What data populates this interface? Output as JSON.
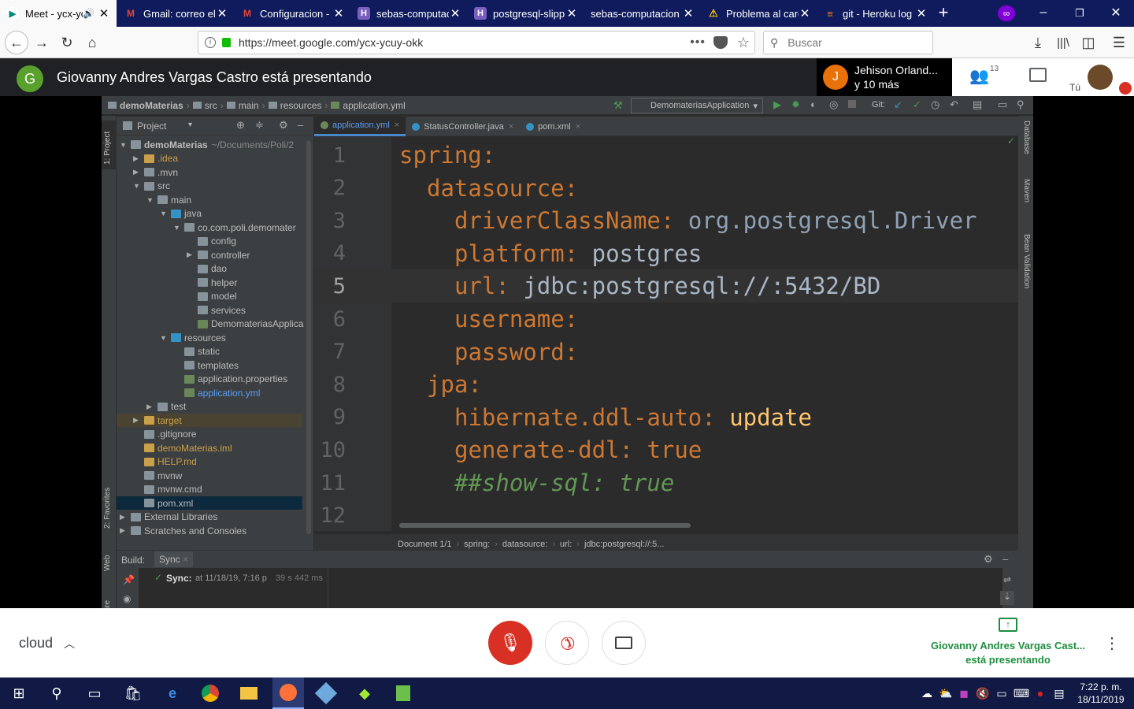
{
  "browser": {
    "tabs": [
      {
        "label": "Meet - ycx-yc",
        "icon": "meet-icon",
        "active": true
      },
      {
        "label": "Gmail: correo el",
        "icon": "gmail-icon"
      },
      {
        "label": "Configuracion -",
        "icon": "gmail-icon"
      },
      {
        "label": "sebas-computac",
        "icon": "heroku-icon"
      },
      {
        "label": "postgresql-slipp",
        "icon": "heroku-icon"
      },
      {
        "label": "sebas-computacion",
        "icon": "blank-icon"
      },
      {
        "label": "Problema al carg",
        "icon": "warning-icon"
      },
      {
        "label": "git - Heroku log",
        "icon": "stackoverflow-icon"
      }
    ],
    "url": "https://meet.google.com/ycx-ycuy-okk",
    "search_placeholder": "Buscar"
  },
  "meet": {
    "presenter_initial": "G",
    "presenter_text": "Giovanny Andres Vargas Castro está presentando",
    "participant_initial": "J",
    "participant_name": "Jehison Orland...",
    "participant_more": "y 10 más",
    "people_count": "13",
    "you_label": "Tú",
    "meeting_name": "cloud",
    "presenting_line1": "Giovanny Andres Vargas Cast...",
    "presenting_line2": "está presentando"
  },
  "ide": {
    "breadcrumb": [
      "demoMaterias",
      "src",
      "main",
      "resources",
      "application.yml"
    ],
    "run_config": "DemomateriasApplication",
    "git_label": "Git:",
    "project_label": "Project",
    "project_side_tab": "1: Project",
    "favorites_side_tab": "2: Favorites",
    "web_side_tab": "Web",
    "structure_side_tab": "ructure",
    "right_tabs": [
      "Database",
      "Maven",
      "Bean Validation"
    ],
    "editor_tabs": [
      "application.yml",
      "StatusController.java",
      "pom.xml"
    ],
    "tree": [
      {
        "label": "demoMaterias",
        "extra": "~/Documents/Poli/2",
        "indent": 0,
        "arrow": "▼",
        "color": "#bbbbbb",
        "bold": true
      },
      {
        "label": ".idea",
        "indent": 1,
        "arrow": "▶",
        "color": "#c9a049"
      },
      {
        "label": ".mvn",
        "indent": 1,
        "arrow": "▶",
        "color": "#bbbbbb"
      },
      {
        "label": "src",
        "indent": 1,
        "arrow": "▼",
        "color": "#bbbbbb"
      },
      {
        "label": "main",
        "indent": 2,
        "arrow": "▼",
        "color": "#bbbbbb"
      },
      {
        "label": "java",
        "indent": 3,
        "arrow": "▼",
        "color": "#bbbbbb"
      },
      {
        "label": "co.com.poli.demomater",
        "indent": 4,
        "arrow": "▼",
        "color": "#bbbbbb"
      },
      {
        "label": "config",
        "indent": 5,
        "arrow": "",
        "color": "#bbbbbb"
      },
      {
        "label": "controller",
        "indent": 5,
        "arrow": "▶",
        "color": "#bbbbbb"
      },
      {
        "label": "dao",
        "indent": 5,
        "arrow": "",
        "color": "#bbbbbb"
      },
      {
        "label": "helper",
        "indent": 5,
        "arrow": "",
        "color": "#bbbbbb"
      },
      {
        "label": "model",
        "indent": 5,
        "arrow": "",
        "color": "#bbbbbb"
      },
      {
        "label": "services",
        "indent": 5,
        "arrow": "",
        "color": "#bbbbbb"
      },
      {
        "label": "DemomateriasApplica",
        "indent": 5,
        "arrow": "",
        "color": "#bbbbbb"
      },
      {
        "label": "resources",
        "indent": 3,
        "arrow": "▼",
        "color": "#bbbbbb"
      },
      {
        "label": "static",
        "indent": 4,
        "arrow": "",
        "color": "#bbbbbb"
      },
      {
        "label": "templates",
        "indent": 4,
        "arrow": "",
        "color": "#bbbbbb"
      },
      {
        "label": "application.properties",
        "indent": 4,
        "arrow": "",
        "color": "#bbbbbb"
      },
      {
        "label": "application.yml",
        "indent": 4,
        "arrow": "",
        "color": "#589df6"
      },
      {
        "label": "test",
        "indent": 2,
        "arrow": "▶",
        "color": "#bbbbbb"
      },
      {
        "label": "target",
        "indent": 1,
        "arrow": "▶",
        "color": "#c9a049"
      },
      {
        "label": ".gitignore",
        "indent": 1,
        "arrow": "",
        "color": "#bbbbbb"
      },
      {
        "label": "demoMaterias.iml",
        "indent": 1,
        "arrow": "",
        "color": "#c9a049"
      },
      {
        "label": "HELP.md",
        "indent": 1,
        "arrow": "",
        "color": "#c9a049"
      },
      {
        "label": "mvnw",
        "indent": 1,
        "arrow": "",
        "color": "#bbbbbb"
      },
      {
        "label": "mvnw.cmd",
        "indent": 1,
        "arrow": "",
        "color": "#bbbbbb"
      },
      {
        "label": "pom.xml",
        "indent": 1,
        "arrow": "",
        "color": "#bbbbbb"
      },
      {
        "label": "External Libraries",
        "indent": 0,
        "arrow": "▶",
        "color": "#bbbbbb"
      },
      {
        "label": "Scratches and Consoles",
        "indent": 0,
        "arrow": "▶",
        "color": "#bbbbbb"
      }
    ],
    "code": [
      {
        "n": "1",
        "indent": 0,
        "key": "spring",
        "val": "",
        "type": "key"
      },
      {
        "n": "2",
        "indent": 1,
        "key": "datasource",
        "val": "",
        "type": "key"
      },
      {
        "n": "3",
        "indent": 2,
        "key": "driverClassName",
        "val": "org.postgresql.Driver",
        "type": "kv"
      },
      {
        "n": "4",
        "indent": 2,
        "key": "platform",
        "val": "postgres",
        "type": "kv"
      },
      {
        "n": "5",
        "indent": 2,
        "key": "url",
        "val": "jdbc:postgresql://:5432/BD",
        "type": "kv"
      },
      {
        "n": "6",
        "indent": 2,
        "key": "username",
        "val": "",
        "type": "key"
      },
      {
        "n": "7",
        "indent": 2,
        "key": "password",
        "val": "",
        "type": "key"
      },
      {
        "n": "8",
        "indent": 1,
        "key": "jpa",
        "val": "",
        "type": "key"
      },
      {
        "n": "9",
        "indent": 2,
        "key": "hibernate.ddl-auto",
        "val": "update",
        "type": "kw"
      },
      {
        "n": "10",
        "indent": 2,
        "key": "generate-ddl",
        "val": "true",
        "type": "kw"
      },
      {
        "n": "11",
        "indent": 2,
        "key": "##show-sql: true",
        "val": "",
        "type": "comment"
      },
      {
        "n": "12",
        "indent": 0,
        "key": "",
        "val": "",
        "type": "empty"
      }
    ],
    "status_crumbs": [
      "Document 1/1",
      "spring:",
      "datasource:",
      "url:",
      "jdbc:postgresql://:5..."
    ],
    "build_label": "Build:",
    "sync_tab": "Sync",
    "sync_text": "Sync:",
    "sync_detail": "at 11/18/19, 7:16 p",
    "sync_time": "39 s 442 ms"
  },
  "taskbar": {
    "time": "7:22 p. m.",
    "date": "18/11/2019"
  },
  "colors": {
    "tabbar_bg": "#0f1b5c",
    "meet_bg": "#202124",
    "ide_bg": "#2b2b2b",
    "end_call_red": "#d93025",
    "meet_green": "#1e8e3e"
  }
}
